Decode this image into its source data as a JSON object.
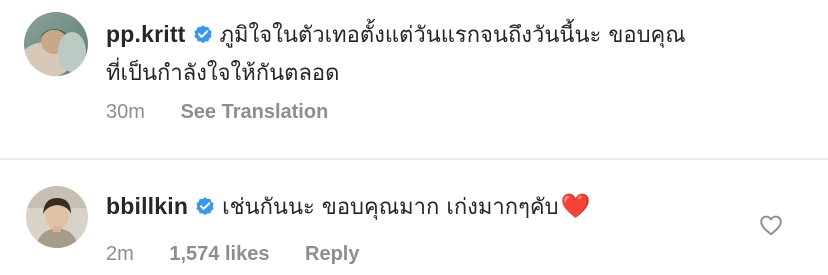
{
  "comments": [
    {
      "username": "pp.kritt",
      "verified": true,
      "text_line1": "ภูมิใจในตัวเทอตั้งแต่วันแรกจนถึงวันนี้นะ ขอบคุณ",
      "text_line2": "ที่เป็นกำลังใจให้กันตลอด",
      "time": "30m",
      "action": "See Translation",
      "avatar_icon": "avatar-photo-icon"
    },
    {
      "username": "bbillkin",
      "verified": true,
      "text": "เช่นกันนะ ขอบคุณมาก เก่งมากๆคับ",
      "emoji": "❤️",
      "time": "2m",
      "likes": "1,574 likes",
      "action": "Reply",
      "avatar_icon": "avatar-photo-icon",
      "like_icon": "heart-outline-icon"
    }
  ],
  "colors": {
    "text_primary": "#262626",
    "text_secondary": "#8e8e8e",
    "verified_blue": "#3897f0",
    "divider": "#ececec",
    "heart_red": "#e0182d"
  }
}
